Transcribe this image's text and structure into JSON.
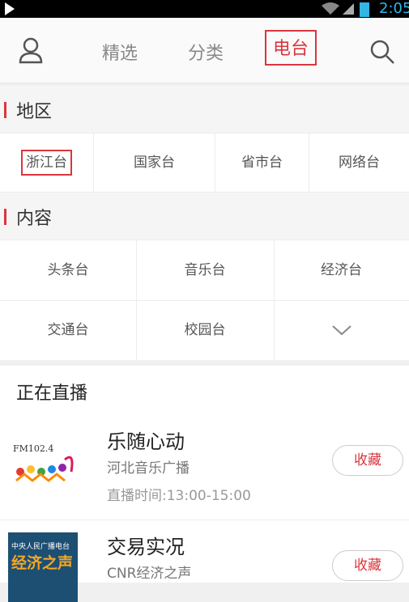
{
  "status_bar": {
    "time": "2:05",
    "icons": [
      "play-icon",
      "wifi-icon",
      "signal-icon",
      "battery-icon"
    ]
  },
  "nav": {
    "user_icon": "user-icon",
    "tabs": [
      {
        "label": "精选",
        "active": false
      },
      {
        "label": "分类",
        "active": false
      },
      {
        "label": "电台",
        "active": true
      }
    ],
    "search_icon": "search-icon"
  },
  "region": {
    "title": "地区",
    "items": [
      "浙江台",
      "国家台",
      "省市台",
      "网络台"
    ],
    "selected": "浙江台"
  },
  "content": {
    "title": "内容",
    "items": [
      "头条台",
      "音乐台",
      "经济台",
      "交通台",
      "校园台"
    ],
    "expand_icon": "chevron-down-icon"
  },
  "live": {
    "heading": "正在直播",
    "items": [
      {
        "name": "乐随心动",
        "station": "河北音乐广播",
        "time": "直播时间:13:00-15:00",
        "fav_label": "收藏",
        "logo_text": "FM102.4"
      },
      {
        "name": "交易实况",
        "station": "CNR经济之声",
        "fav_label": "收藏",
        "logo_text_top": "中央人民广播电台",
        "logo_text_main": "经济之声"
      }
    ]
  },
  "colors": {
    "accent": "#d9363e",
    "status_blue": "#33b5e5"
  }
}
